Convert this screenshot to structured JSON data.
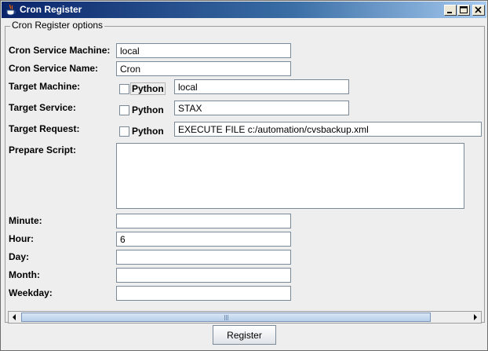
{
  "window": {
    "title": "Cron Register"
  },
  "group": {
    "title": "Cron Register options"
  },
  "labels": {
    "service_machine": "Cron Service Machine:",
    "service_name": "Cron Service Name:",
    "target_machine": "Target Machine:",
    "target_service": "Target Service:",
    "target_request": "Target Request:",
    "prepare_script": "Prepare Script:",
    "minute": "Minute:",
    "hour": "Hour:",
    "day": "Day:",
    "month": "Month:",
    "weekday": "Weekday:"
  },
  "values": {
    "service_machine": "local",
    "service_name": "Cron",
    "target_machine": "local",
    "target_service": "STAX",
    "target_request": "EXECUTE FILE c:/automation/cvsbackup.xml",
    "prepare_script": "",
    "minute": "",
    "hour": "6",
    "day": "",
    "month": "",
    "weekday": ""
  },
  "python_checkbox_label": "Python",
  "register_button": "Register",
  "icons": {
    "title": "java-cup-icon",
    "minimize": "minimize-icon",
    "maximize": "maximize-icon",
    "close": "close-icon",
    "scroll_left": "arrow-left-icon",
    "scroll_right": "arrow-right-icon"
  }
}
